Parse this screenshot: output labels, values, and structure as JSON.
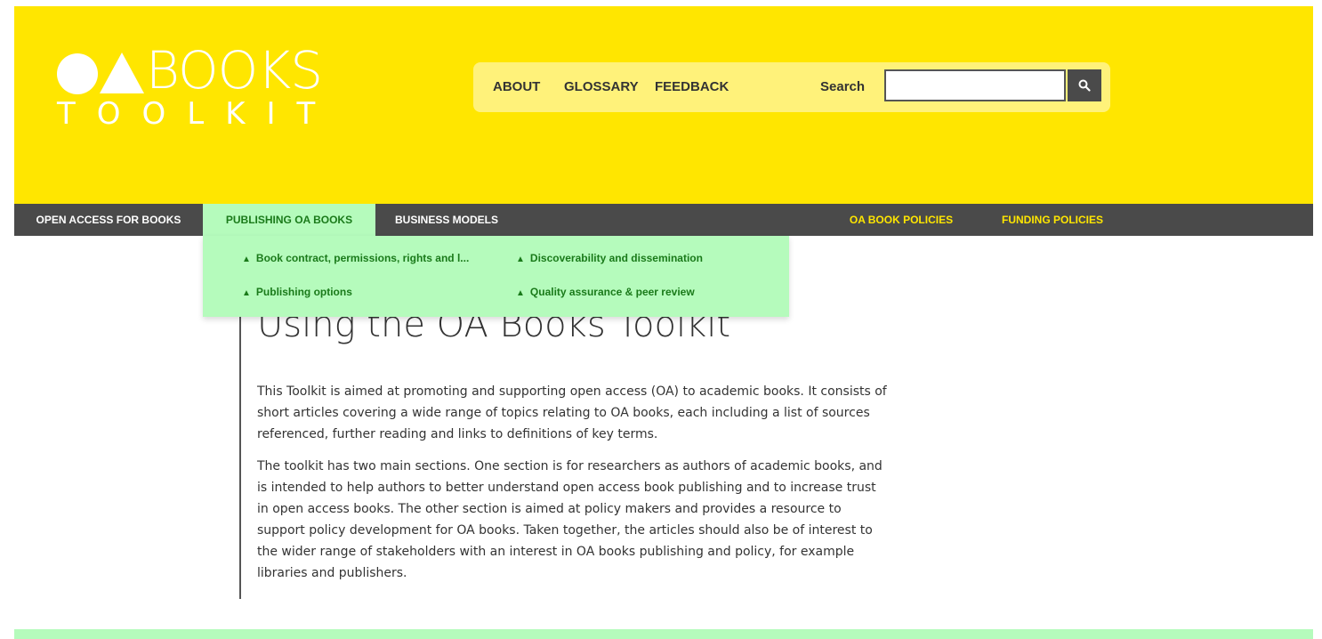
{
  "logo": {
    "word": "BOOKS",
    "subtitle": "TOOLKIT"
  },
  "topbar": {
    "links": [
      "ABOUT",
      "GLOSSARY",
      "FEEDBACK"
    ],
    "search_label": "Search",
    "search_value": ""
  },
  "nav": {
    "items": [
      "OPEN ACCESS FOR BOOKS",
      "PUBLISHING OA BOOKS",
      "BUSINESS MODELS",
      "OA BOOK POLICIES",
      "FUNDING POLICIES"
    ],
    "active": "PUBLISHING OA BOOKS"
  },
  "dropdown": {
    "arrow": "▲",
    "items": [
      "Book contract, permissions, rights and l...",
      "Discoverability and dissemination",
      "Publishing options",
      "Quality assurance & peer review"
    ]
  },
  "main": {
    "title": "Using the OA Books Toolkit",
    "paragraphs": [
      "This Toolkit is aimed at promoting and supporting open access (OA) to academic books. It consists of short articles covering a wide range of topics relating to OA books, each including a list of sources referenced, further reading and links to definitions of key terms.",
      "The toolkit has two main sections. One section is for researchers as authors of academic books, and is intended to help authors to better understand open access book publishing and to increase trust in open access books. The other section is aimed at policy makers and provides a resource to support policy development for OA books. Taken together, the articles should also be of interest to the wider range of stakeholders with an interest in OA books publishing and policy, for example libraries and publishers."
    ]
  },
  "colors": {
    "header_yellow": "#ffe600",
    "topbar_light_yellow": "#fff27a",
    "nav_grey": "#4a4a4a",
    "active_green": "#b5fbbc",
    "green_text": "#1a7a1a"
  },
  "icons": {
    "search": "search-icon"
  }
}
